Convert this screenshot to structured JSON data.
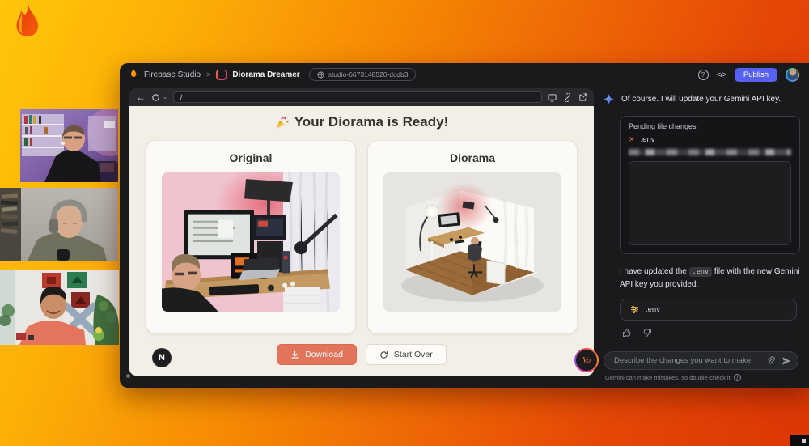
{
  "header": {
    "app_name": "Firebase Studio",
    "breadcrumb_sep": ">",
    "workspace_name": "Diorama Dreamer",
    "workspace_id": "studio-6673148520-dcdb3",
    "help_glyph": "?",
    "code_glyph": "</>",
    "publish_label": "Publish"
  },
  "toolbar": {
    "back_glyph": "←",
    "refresh_caret": "⌄",
    "url": "/"
  },
  "preview": {
    "title": "Your Diorama is Ready!",
    "cards": [
      {
        "title": "Original"
      },
      {
        "title": "Diorama"
      }
    ],
    "download_label": "Download",
    "start_over_label": "Start Over",
    "framework_badge": "N"
  },
  "chat": {
    "message_intro": "Of course. I will update your Gemini API key.",
    "pending": {
      "title": "Pending file changes",
      "close_glyph": "✕",
      "file": ".env"
    },
    "message_result": {
      "before": "I have updated the ",
      "code": ".env",
      "after": " file with the new Gemini API key you provided."
    },
    "file_chip": ".env",
    "badge_label": "Vo",
    "input_placeholder": "Describe the changes you want to make",
    "disclaimer": "Gemini can make mistakes, so double-check it",
    "info_glyph": "i"
  },
  "colors": {
    "background_yellow": "#ffc60a",
    "background_red": "#dc3604",
    "publish_accent": "#5661f1",
    "download_accent": "#e2745c",
    "gemini_blue": "#4e86f5",
    "flame_orange": "#f57b02"
  }
}
